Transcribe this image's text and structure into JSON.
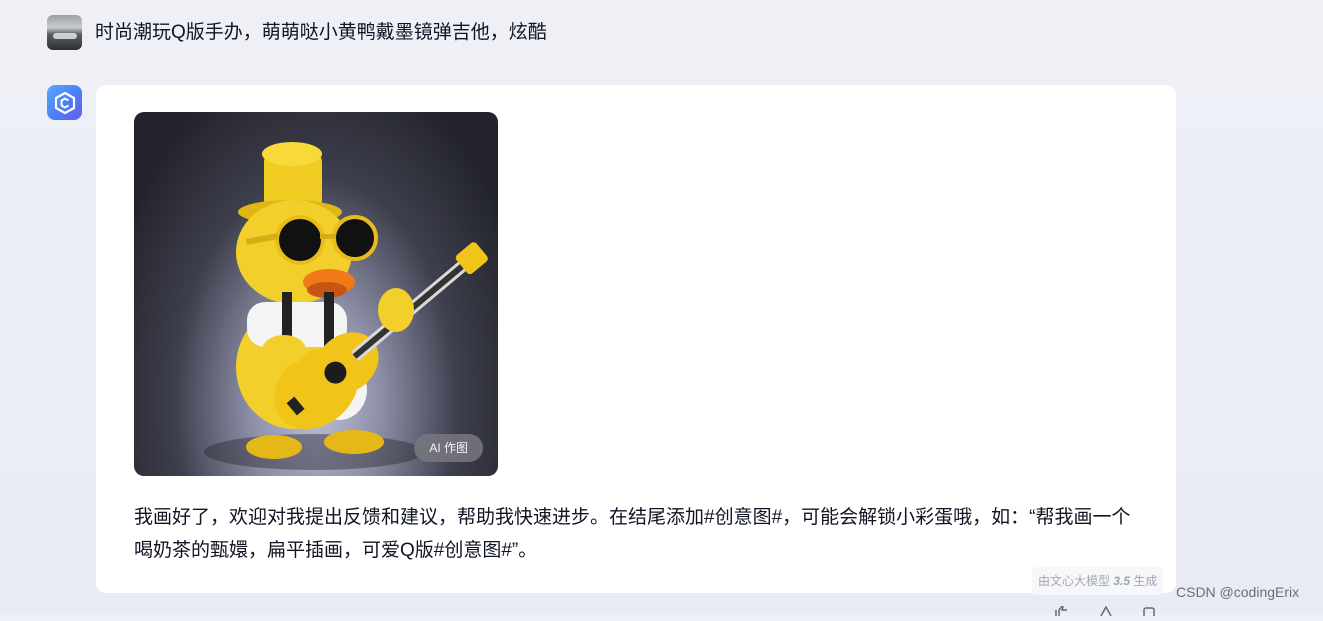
{
  "user": {
    "message": "时尚潮玩Q版手办，萌萌哒小黄鸭戴墨镜弹吉他，炫酷"
  },
  "bot": {
    "image_badge": "AI 作图",
    "reply": "我画好了，欢迎对我提出反馈和建议，帮助我快速进步。在结尾添加#创意图#，可能会解锁小彩蛋哦，如：“帮我画一个喝奶茶的甄嬛，扁平插画，可爱Q版#创意图#”。",
    "model_prefix": "由文心大模型",
    "model_version": "3.5",
    "model_suffix": "生成"
  },
  "watermark": "CSDN @codingErix",
  "colors": {
    "page_bg": "#eceef6",
    "card_bg": "#ffffff",
    "bot_avatar": "#4d7cf8",
    "duck_yellow": "#f2cf2b"
  },
  "icons": {
    "user_avatar": "landscape-photo-avatar",
    "bot_avatar": "ernie-bot-logo-icon",
    "actions": [
      "thumb-up-icon",
      "thumb-down-icon",
      "copy-icon"
    ]
  }
}
